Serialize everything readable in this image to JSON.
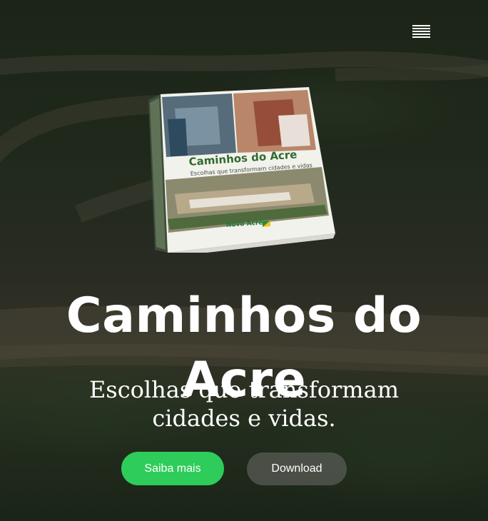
{
  "hero": {
    "title": "Caminhos do Acre",
    "subtitle": "Escolhas que transformam cidades e vidas.",
    "primary_button": "Saiba mais",
    "secondary_button": "Download"
  },
  "book": {
    "cover_title": "Caminhos do Acre",
    "cover_subtitle": "Escolhas que transformam cidades e vidas",
    "logo_text": "Novo Acre"
  },
  "colors": {
    "accent": "#2ecc5a",
    "secondary_button": "#6e6e69"
  },
  "icons": {
    "menu": "hamburger-menu-icon"
  }
}
